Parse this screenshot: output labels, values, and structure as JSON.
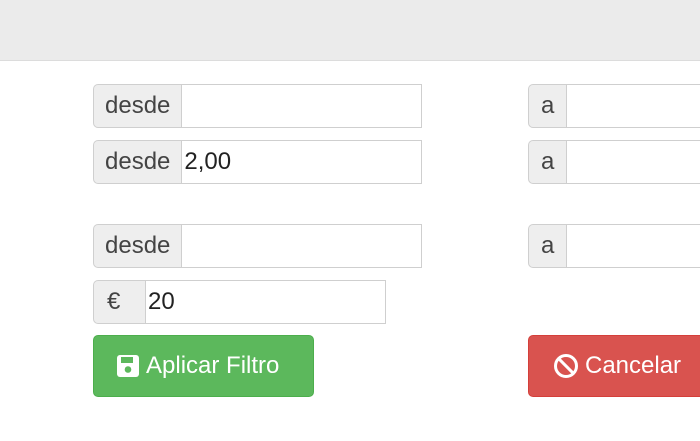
{
  "filters": {
    "row1": {
      "from_label": "desde",
      "from_value": "",
      "to_label": "a",
      "to_value": ""
    },
    "row2": {
      "from_label": "desde",
      "from_value": "2,00",
      "to_label": "a",
      "to_value": ""
    },
    "row3": {
      "from_label": "desde",
      "from_value": "",
      "to_label": "a",
      "to_value": ""
    },
    "price": {
      "currency_symbol": "€",
      "value": "20"
    }
  },
  "buttons": {
    "apply_label": "Aplicar Filtro",
    "apply_icon": "save-icon",
    "cancel_label": "Cancelar",
    "cancel_icon": "ban-icon"
  },
  "colors": {
    "topbar": "#ebebeb",
    "success": "#5cb85c",
    "danger": "#d9534f"
  }
}
